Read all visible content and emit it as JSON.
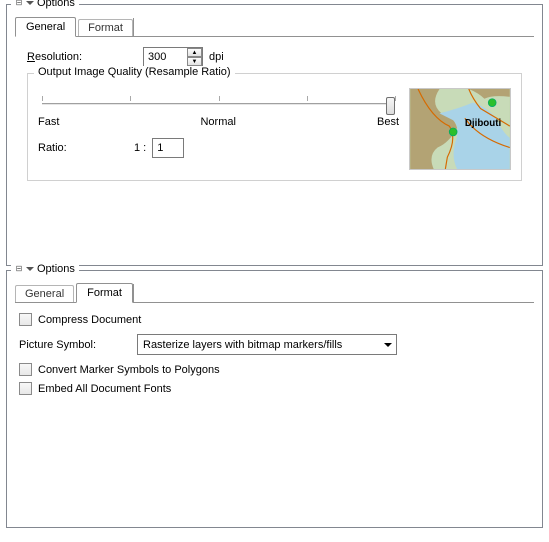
{
  "panel1": {
    "title": "Options",
    "tabs": {
      "general": "General",
      "format": "Format"
    },
    "resolution": {
      "label": "Resolution:",
      "value": "300",
      "unit": "dpi"
    },
    "quality": {
      "title": "Output Image Quality (Resample Ratio)",
      "labels": {
        "fast": "Fast",
        "normal": "Normal",
        "best": "Best"
      },
      "ratio_label": "Ratio:",
      "ratio_prefix": "1 :",
      "ratio_value": "1"
    },
    "map_label": "Djibouti"
  },
  "panel2": {
    "title": "Options",
    "tabs": {
      "general": "General",
      "format": "Format"
    },
    "compress": "Compress Document",
    "picture_symbol_label": "Picture Symbol:",
    "picture_symbol_value": "Rasterize layers with bitmap markers/fills",
    "convert": "Convert Marker Symbols to Polygons",
    "embed": "Embed All Document Fonts"
  }
}
